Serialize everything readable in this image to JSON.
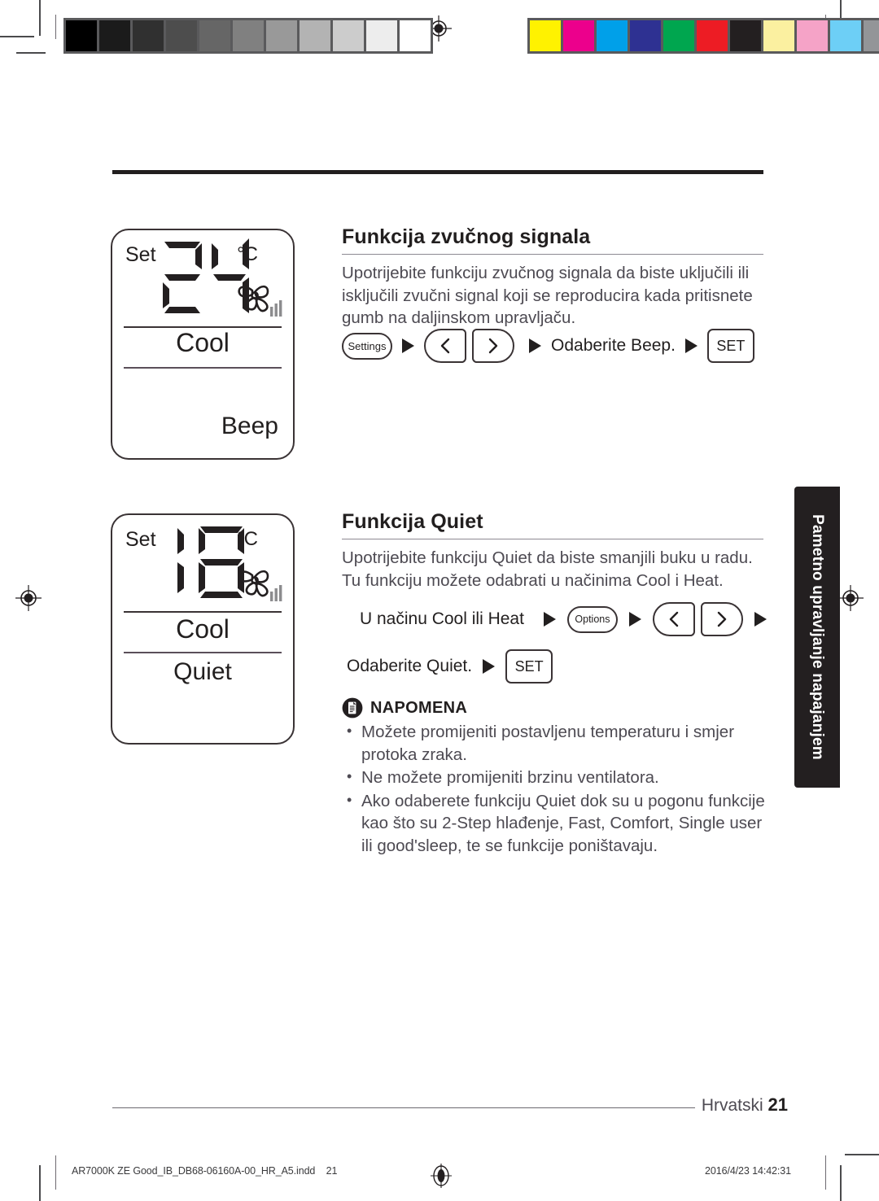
{
  "print_marks": {
    "grayscale_swatches": [
      "#000000",
      "#1b1b1b",
      "#303030",
      "#4d4d4d",
      "#666666",
      "#808080",
      "#999999",
      "#b3b3b3",
      "#cccccc",
      "#ededed",
      "#ffffff"
    ],
    "color_swatches": [
      "#fff200",
      "#ec008c",
      "#00a0e9",
      "#2e3192",
      "#00a64f",
      "#ed1c24",
      "#231f20",
      "#fbf0a0",
      "#f5a3c7",
      "#6dcff6",
      "#939598"
    ],
    "registration_mark": "registration-target"
  },
  "sections": [
    {
      "id": "beep",
      "title": "Funkcija zvučnog signala",
      "body": "Upotrijebite funkciju zvučnog signala da biste uključili ili isključili zvučni signal koji se reproducira kada pritisnete gumb na daljinskom upravljaču.",
      "steps": [
        {
          "type": "pill",
          "label": "Settings"
        },
        {
          "type": "arrow-right-marker"
        },
        {
          "type": "arrow-button",
          "icon": "chevron-left-icon"
        },
        {
          "type": "arrow-button",
          "icon": "chevron-right-icon"
        },
        {
          "type": "arrow-right-marker"
        },
        {
          "type": "text",
          "label": "Odaberite Beep."
        },
        {
          "type": "arrow-right-marker"
        },
        {
          "type": "set",
          "label": "SET"
        }
      ]
    },
    {
      "id": "quiet",
      "title": "Funkcija Quiet",
      "body": "Upotrijebite funkciju Quiet da biste smanjili buku u radu. Tu funkciju možete odabrati u načinima Cool i Heat.",
      "steps_row1": [
        {
          "type": "text",
          "label": "U načinu Cool ili Heat"
        },
        {
          "type": "arrow-right-marker"
        },
        {
          "type": "pill",
          "label": "Options"
        },
        {
          "type": "arrow-right-marker"
        },
        {
          "type": "arrow-button",
          "icon": "chevron-left-icon"
        },
        {
          "type": "arrow-button",
          "icon": "chevron-right-icon"
        },
        {
          "type": "arrow-right-marker"
        }
      ],
      "steps_row2": [
        {
          "type": "text",
          "label": "Odaberite Quiet."
        },
        {
          "type": "arrow-right-marker"
        },
        {
          "type": "set",
          "label": "SET"
        }
      ]
    }
  ],
  "lcd_panels": [
    {
      "id": "lcd-beep",
      "set_label": "Set",
      "temperature": "24",
      "unit": "°C",
      "mode": "Cool",
      "function_label": "Beep",
      "fan_icon": "fan-icon",
      "fan_bars": 3
    },
    {
      "id": "lcd-quiet",
      "set_label": "Set",
      "temperature": "18",
      "unit": "°C",
      "mode": "Cool",
      "function_label": "Quiet",
      "fan_icon": "fan-icon",
      "fan_bars": 3
    }
  ],
  "note": {
    "icon": "note-document-icon",
    "heading": "NAPOMENA",
    "items": [
      "Možete promijeniti postavljenu temperaturu i smjer protoka zraka.",
      "Ne možete promijeniti brzinu ventilatora.",
      "Ako odaberete funkciju Quiet dok su u pogonu funkcije kao što su 2-Step hlađenje, Fast, Comfort, Single user ili good'sleep, te se funkcije poništavaju."
    ]
  },
  "side_tab": {
    "label": "Pametno upravljanje napajanjem",
    "background": "#231f20",
    "text_color": "#ffffff"
  },
  "page_footer": {
    "language": "Hrvatski",
    "page_number": "21"
  },
  "imposition_footer": {
    "file_name": "AR7000K ZE Good_IB_DB68-06160A-00_HR_A5.indd",
    "page": "21",
    "timestamp": "2016/4/23  14:42:31"
  }
}
